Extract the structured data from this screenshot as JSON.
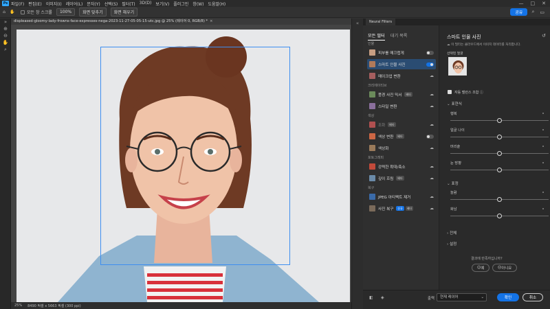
{
  "app": {
    "logo": "Ps"
  },
  "menu": [
    "파일(F)",
    "편집(E)",
    "이미지(I)",
    "레이어(L)",
    "문자(Y)",
    "선택(S)",
    "필터(T)",
    "3D(D)",
    "보기(V)",
    "플러그인",
    "창(W)",
    "도움말(H)"
  ],
  "window_controls": [
    "—",
    "□",
    "✕"
  ],
  "options": {
    "all_windows_label": "모든 창 스크롤",
    "zoom_value": "100%",
    "fit_screen": "화면 맞추기",
    "fill_screen": "화면 채우기",
    "share": "공유"
  },
  "document": {
    "tab_title": "displeased-gloomy-lady-frowns-face-expresses-nega-2023-11-27-05-05-15-utc.jpg @ 25% (레이어 0, RGB/8) *",
    "close": "×",
    "zoom": "25%",
    "dimensions": "8490 픽셀 x 5663 픽셀 (300 ppi)"
  },
  "panel": {
    "header_tab": "Neural Filters",
    "tabs": {
      "all": "모든 필터",
      "waitlist": "대기 목록"
    },
    "categories": [
      {
        "name": "인물",
        "items": [
          {
            "label": "피부를 매끄럽게",
            "control": "toggle-off",
            "color": "#c79e82"
          },
          {
            "label": "스마트 인물 사진",
            "control": "toggle-on",
            "selected": true,
            "color": "#b07a5a"
          },
          {
            "label": "메이크업 변환",
            "control": "cloud",
            "color": "#a65e5e"
          }
        ]
      },
      {
        "name": "크리에이티브",
        "items": [
          {
            "label": "풍경 사진 믹서",
            "control": "cloud",
            "tag": "베타",
            "color": "#6b8b5b"
          },
          {
            "label": "스타일 변환",
            "control": "cloud",
            "color": "#8a6f9c"
          }
        ]
      },
      {
        "name": "색상",
        "items": [
          {
            "label": "조화",
            "control": "cloud",
            "tag": "베타",
            "dim": true,
            "color": "#b05050"
          },
          {
            "label": "색상 변환",
            "control": "toggle-off",
            "tag": "베타",
            "color": "#cc6644"
          },
          {
            "label": "색상화",
            "control": "cloud",
            "color": "#9a7a5a"
          }
        ]
      },
      {
        "name": "포토그래피",
        "items": [
          {
            "label": "강력한 확대/축소",
            "control": "cloud",
            "color": "#c24a3a"
          },
          {
            "label": "깊이 흐림",
            "control": "cloud",
            "tag": "베타",
            "color": "#6a8aa8"
          }
        ]
      },
      {
        "name": "복구",
        "items": [
          {
            "label": "JPEG 아티팩트 제거",
            "control": "cloud",
            "color": "#3a6aa8"
          },
          {
            "label": "사진 복구",
            "control": "cloud",
            "tag": "신규",
            "tag2": "베타",
            "color": "#7a6a5a"
          }
        ]
      }
    ],
    "settings": {
      "title": "스마트 인물 사진",
      "subtitle": "이 필터는 클라우드에서 이미지 데이터를 처리합니다.",
      "selected_face": "선택된 얼굴",
      "auto_balance": "자동 밸런스 조합",
      "sections": {
        "expression": "표현식",
        "mood": "표정",
        "global": "전체",
        "settings": "설정"
      },
      "sliders_expression": [
        {
          "label": "행복",
          "value": 0
        },
        {
          "label": "얼굴 나이",
          "value": 0
        },
        {
          "label": "머리숱",
          "value": 0
        },
        {
          "label": "눈 방향",
          "value": 0
        }
      ],
      "sliders_mood": [
        {
          "label": "놀람",
          "value": 0
        },
        {
          "label": "화남",
          "value": 0
        }
      ],
      "feedback_q": "결과에 만족하십니까?",
      "yes": "예",
      "no": "아니요"
    },
    "bottom": {
      "output_label": "출력",
      "output_value": "현재 레이어",
      "ok": "확인",
      "cancel": "취소"
    }
  }
}
